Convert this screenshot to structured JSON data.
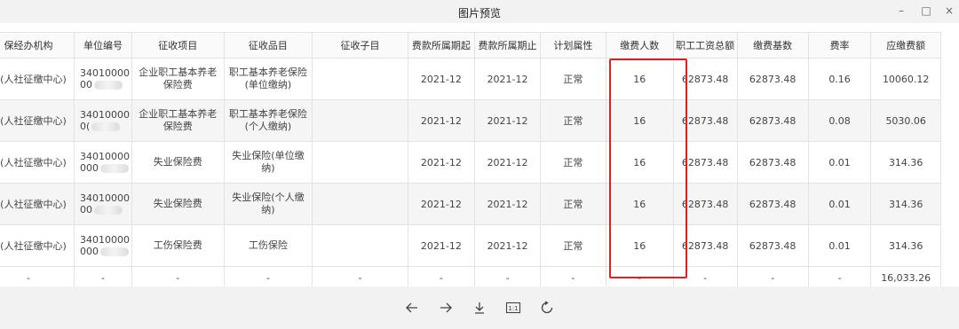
{
  "window": {
    "title": "图片预览",
    "min_glyph": "–",
    "max_glyph": "□",
    "close_glyph": "×"
  },
  "table": {
    "headers": [
      "保经办机构",
      "单位编号",
      "征收项目",
      "征收品目",
      "征收子目",
      "费款所属期起",
      "费款所属期止",
      "计划属性",
      "缴费人数",
      "职工工资总额",
      "缴费基数",
      "费率",
      "应缴费额"
    ],
    "rows": [
      {
        "org": "业(人社征缴中心)",
        "code_top": "34010000",
        "code_bot": "00",
        "item": "企业职工基本养老保险费",
        "sub_item": "职工基本养老保险(单位缴纳)",
        "sub_sub": "",
        "start": "2021-12",
        "end": "2021-12",
        "plan": "正常",
        "people": "16",
        "wage_total": "62873.48",
        "base": "62873.48",
        "rate": "0.16",
        "due": "10060.12"
      },
      {
        "org": "业(人社征缴中心)",
        "code_top": "34010000",
        "code_bot": "0(",
        "item": "企业职工基本养老保险费",
        "sub_item": "职工基本养老保险(个人缴纳)",
        "sub_sub": "",
        "start": "2021-12",
        "end": "2021-12",
        "plan": "正常",
        "people": "16",
        "wage_total": "62873.48",
        "base": "62873.48",
        "rate": "0.08",
        "due": "5030.06"
      },
      {
        "org": "业(人社征缴中心)",
        "code_top": "34010000",
        "code_bot": "000",
        "item": "失业保险费",
        "sub_item": "失业保险(单位缴纳)",
        "sub_sub": "",
        "start": "2021-12",
        "end": "2021-12",
        "plan": "正常",
        "people": "16",
        "wage_total": "62873.48",
        "base": "62873.48",
        "rate": "0.01",
        "due": "314.36"
      },
      {
        "org": "业(人社征缴中心)",
        "code_top": "34010000",
        "code_bot": "00",
        "item": "失业保险费",
        "sub_item": "失业保险(个人缴纳)",
        "sub_sub": "",
        "start": "2021-12",
        "end": "2021-12",
        "plan": "正常",
        "people": "16",
        "wage_total": "62873.48",
        "base": "62873.48",
        "rate": "0.01",
        "due": "314.36"
      },
      {
        "org": "业(人社征缴中心)",
        "code_top": "34010000",
        "code_bot": "000",
        "item": "工伤保险费",
        "sub_item": "工伤保险",
        "sub_sub": "",
        "start": "2021-12",
        "end": "2021-12",
        "plan": "正常",
        "people": "16",
        "wage_total": "62873.48",
        "base": "62873.48",
        "rate": "0.01",
        "due": "314.36"
      }
    ],
    "total_row": [
      "-",
      "-",
      "-",
      "-",
      "-",
      "-",
      "-",
      "-",
      "-",
      "-",
      "-",
      "-",
      "16,033.26"
    ]
  },
  "toolbar": {
    "icons": [
      "arrow-left-icon",
      "arrow-right-icon",
      "download-icon",
      "actual-size-icon",
      "rotate-icon"
    ],
    "actual_size_label": "1:1"
  }
}
